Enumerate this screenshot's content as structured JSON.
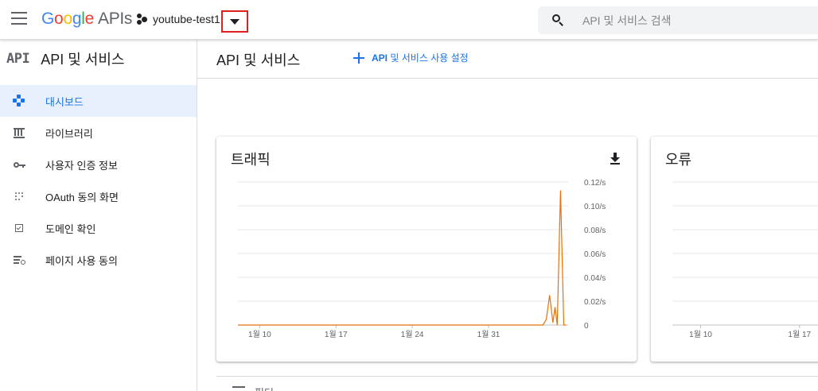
{
  "header": {
    "logo_letters": [
      "G",
      "o",
      "o",
      "g",
      "l",
      "e"
    ],
    "logo_suffix": "APIs",
    "project_name": "youtube-test1",
    "search_placeholder": "API 및 서비스 검색"
  },
  "sidebar": {
    "glyph": "API",
    "title": "API 및 서비스",
    "items": [
      {
        "label": "대시보드",
        "icon": "dashboard-icon",
        "active": true
      },
      {
        "label": "라이브러리",
        "icon": "library-icon",
        "active": false
      },
      {
        "label": "사용자 인증 정보",
        "icon": "key-icon",
        "active": false
      },
      {
        "label": "OAuth 동의 화면",
        "icon": "oauth-icon",
        "active": false
      },
      {
        "label": "도메인 확인",
        "icon": "checkbox-icon",
        "active": false
      },
      {
        "label": "페이지 사용 동의",
        "icon": "settings-list-icon",
        "active": false
      }
    ]
  },
  "main": {
    "title": "API 및 서비스",
    "enable_api_strong": "API",
    "enable_api_rest": "및 서비스 사용 설정",
    "filter_label": "필터"
  },
  "colors": {
    "accent": "#1a73e8",
    "active_bg": "#e8f0fe",
    "series": "#e8710a",
    "highlight": "#e01f1f"
  },
  "chart_data": [
    {
      "type": "line",
      "title": "트래픽",
      "y_tick_labels": [
        "0",
        "0.02/s",
        "0.04/s",
        "0.06/s",
        "0.08/s",
        "0.10/s",
        "0.12/s"
      ],
      "y_ticks": [
        0,
        0.02,
        0.04,
        0.06,
        0.08,
        0.1,
        0.12
      ],
      "ylim": [
        0,
        0.12
      ],
      "x_tick_labels": [
        "1월 10",
        "1월 17",
        "1월 24",
        "1월 31"
      ],
      "x_ticks": [
        10,
        17,
        24,
        31
      ],
      "xlim": [
        8,
        38.3
      ],
      "grid": true,
      "series": [
        {
          "x": [
            8,
            36.0,
            36.3,
            36.6,
            36.9,
            37.1,
            37.3,
            37.6,
            37.9,
            38.1
          ],
          "y": [
            0,
            0,
            0.005,
            0.025,
            0.002,
            0.015,
            0.0,
            0.113,
            0.0,
            0.0
          ]
        }
      ]
    },
    {
      "type": "line",
      "title": "오류",
      "x_tick_labels": [
        "1월 10",
        "1월 17"
      ],
      "x_ticks": [
        10,
        17
      ],
      "xlim": [
        8,
        20
      ],
      "ylim": [
        0,
        0.12
      ],
      "y_ticks": [
        0,
        0.02,
        0.04,
        0.06,
        0.08,
        0.1,
        0.12
      ],
      "grid": true,
      "series": []
    }
  ]
}
